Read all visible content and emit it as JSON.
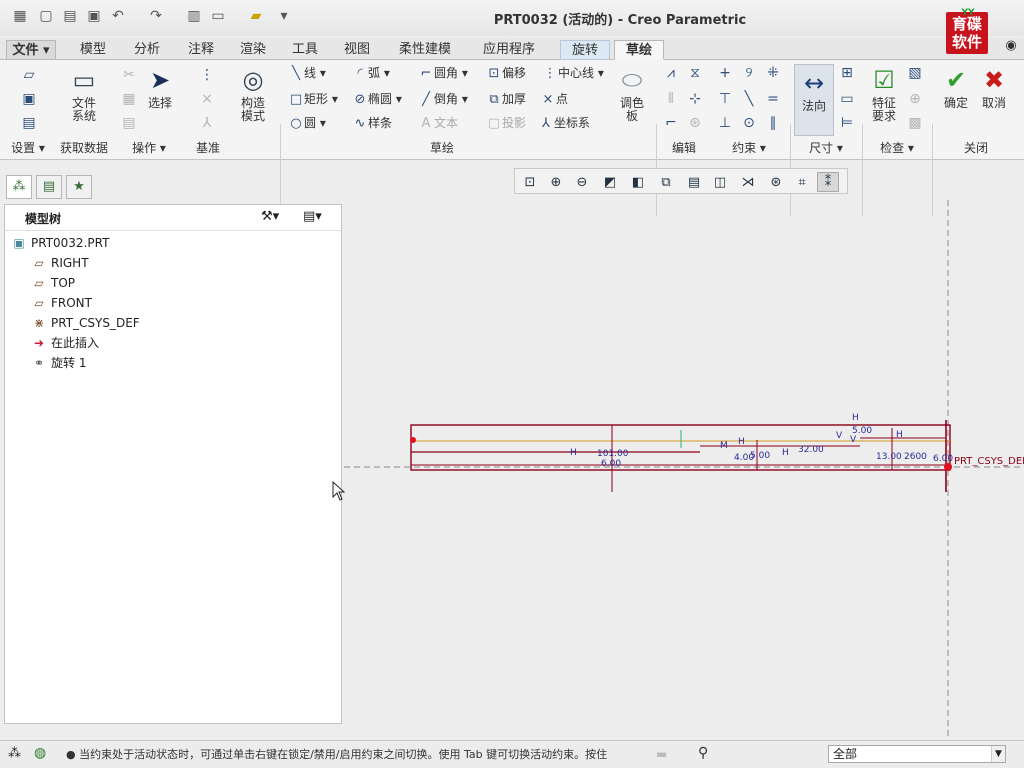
{
  "window": {
    "title": "PRT0032 (活动的) - Creo Parametric",
    "logo_text": "育碟软件",
    "logo_top_text": "YY"
  },
  "menu_tabs": [
    "文件",
    "模型",
    "分析",
    "注释",
    "渲染",
    "工具",
    "视图",
    "柔性建模",
    "应用程序",
    "旋转",
    "草绘"
  ],
  "ribbon": {
    "setup": {
      "big_buttons": {
        "file_system": "文件\n系统",
        "select": "选择"
      }
    },
    "datum": {
      "construction_mode": "构造\n模式"
    },
    "sketch": {
      "line": "线",
      "arc": "弧",
      "fillet": "圆角",
      "offset": "偏移",
      "centerline": "中心线",
      "rectangle": "矩形",
      "ellipse": "椭圆",
      "chamfer": "倒角",
      "thicken": "加厚",
      "point": "点",
      "circle": "圆",
      "spline": "样条",
      "text": "文本",
      "project": "投影",
      "coordinate_system": "坐标系",
      "palette": "调色\n板"
    },
    "dimension": {
      "normal": "法向"
    },
    "inspect": {
      "feature_requirements": "特征\n要求"
    },
    "close": {
      "ok": "确定",
      "cancel": "取消"
    },
    "groups": {
      "settings": "设置",
      "get_data": "获取数据",
      "operations": "操作",
      "datum": "基准",
      "sketch": "草绘",
      "edit": "编辑",
      "constrain": "约束",
      "dimension": "尺寸",
      "inspect": "检查",
      "close": "关闭"
    }
  },
  "model_tree": {
    "title": "模型树",
    "nodes": [
      {
        "label": "PRT0032.PRT",
        "icon": "part-icon"
      },
      {
        "label": "RIGHT",
        "icon": "datum-plane-icon"
      },
      {
        "label": "TOP",
        "icon": "datum-plane-icon"
      },
      {
        "label": "FRONT",
        "icon": "datum-plane-icon"
      },
      {
        "label": "PRT_CSYS_DEF",
        "icon": "csys-icon"
      },
      {
        "label": "在此插入",
        "icon": "insert-arrow-icon"
      },
      {
        "label": "旋转 1",
        "icon": "revolve-icon"
      }
    ]
  },
  "sketch": {
    "dimensions": [
      "101.00",
      "6.00",
      "4.00",
      "5.00",
      "32.00",
      "5.00",
      "13.00",
      "2600",
      "6.00"
    ],
    "constraint_labels": [
      "H",
      "H",
      "H",
      "H",
      "V",
      "V",
      "H",
      "M"
    ],
    "csys_label": "PRT_CSYS_DEF"
  },
  "status": {
    "message": "● 当约束处于活动状态时，可通过单击右键在锁定/禁用/启用约束之间切换。使用 Tab 键可切换活动约束。按住",
    "filter": "全部"
  },
  "colors": {
    "accent": "#c8121c",
    "sketch_line": "#8a0018",
    "dimension_text": "#2a2a9a"
  }
}
